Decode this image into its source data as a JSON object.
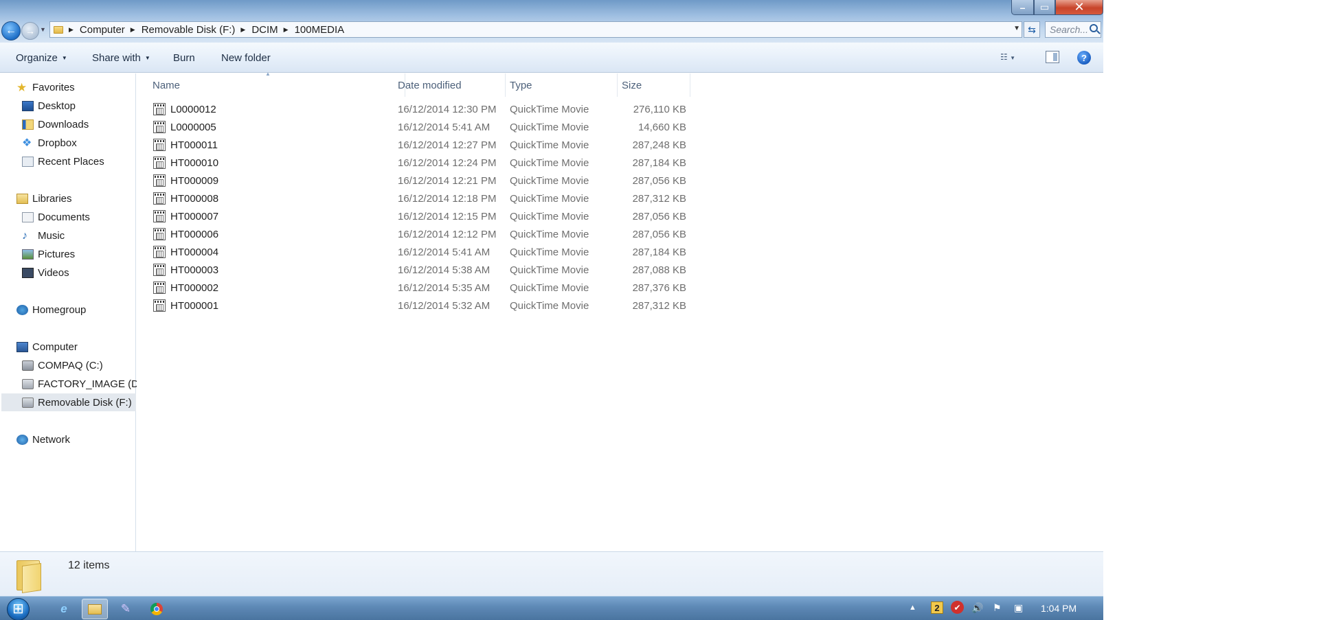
{
  "window": {
    "caption_buttons": {
      "minimize": "–",
      "maximize": "▭",
      "close": "✕"
    }
  },
  "address": {
    "crumbs": [
      "Computer",
      "Removable Disk (F:)",
      "DCIM",
      "100MEDIA"
    ],
    "search_placeholder": "Search..."
  },
  "toolbar": {
    "organize": "Organize",
    "share_with": "Share with",
    "burn": "Burn",
    "new_folder": "New folder"
  },
  "nav": {
    "favorites": "Favorites",
    "desktop": "Desktop",
    "downloads": "Downloads",
    "dropbox": "Dropbox",
    "recent_places": "Recent Places",
    "libraries": "Libraries",
    "documents": "Documents",
    "music": "Music",
    "pictures": "Pictures",
    "videos": "Videos",
    "homegroup": "Homegroup",
    "computer": "Computer",
    "drive_c": "COMPAQ (C:)",
    "drive_d": "FACTORY_IMAGE (D:)",
    "drive_f": "Removable Disk (F:)",
    "network": "Network"
  },
  "columns": {
    "name": "Name",
    "date": "Date modified",
    "type": "Type",
    "size": "Size"
  },
  "files": [
    {
      "name": "L0000012",
      "date": "16/12/2014 12:30 PM",
      "type": "QuickTime Movie",
      "size": "276,110 KB"
    },
    {
      "name": "L0000005",
      "date": "16/12/2014 5:41 AM",
      "type": "QuickTime Movie",
      "size": "14,660 KB"
    },
    {
      "name": "HT000011",
      "date": "16/12/2014 12:27 PM",
      "type": "QuickTime Movie",
      "size": "287,248 KB"
    },
    {
      "name": "HT000010",
      "date": "16/12/2014 12:24 PM",
      "type": "QuickTime Movie",
      "size": "287,184 KB"
    },
    {
      "name": "HT000009",
      "date": "16/12/2014 12:21 PM",
      "type": "QuickTime Movie",
      "size": "287,056 KB"
    },
    {
      "name": "HT000008",
      "date": "16/12/2014 12:18 PM",
      "type": "QuickTime Movie",
      "size": "287,312 KB"
    },
    {
      "name": "HT000007",
      "date": "16/12/2014 12:15 PM",
      "type": "QuickTime Movie",
      "size": "287,056 KB"
    },
    {
      "name": "HT000006",
      "date": "16/12/2014 12:12 PM",
      "type": "QuickTime Movie",
      "size": "287,056 KB"
    },
    {
      "name": "HT000004",
      "date": "16/12/2014 5:41 AM",
      "type": "QuickTime Movie",
      "size": "287,184 KB"
    },
    {
      "name": "HT000003",
      "date": "16/12/2014 5:38 AM",
      "type": "QuickTime Movie",
      "size": "287,088 KB"
    },
    {
      "name": "HT000002",
      "date": "16/12/2014 5:35 AM",
      "type": "QuickTime Movie",
      "size": "287,376 KB"
    },
    {
      "name": "HT000001",
      "date": "16/12/2014 5:32 AM",
      "type": "QuickTime Movie",
      "size": "287,312 KB"
    }
  ],
  "details": {
    "item_count": "12 items"
  },
  "taskbar": {
    "tray_badge": "2",
    "clock": "1:04 PM"
  }
}
